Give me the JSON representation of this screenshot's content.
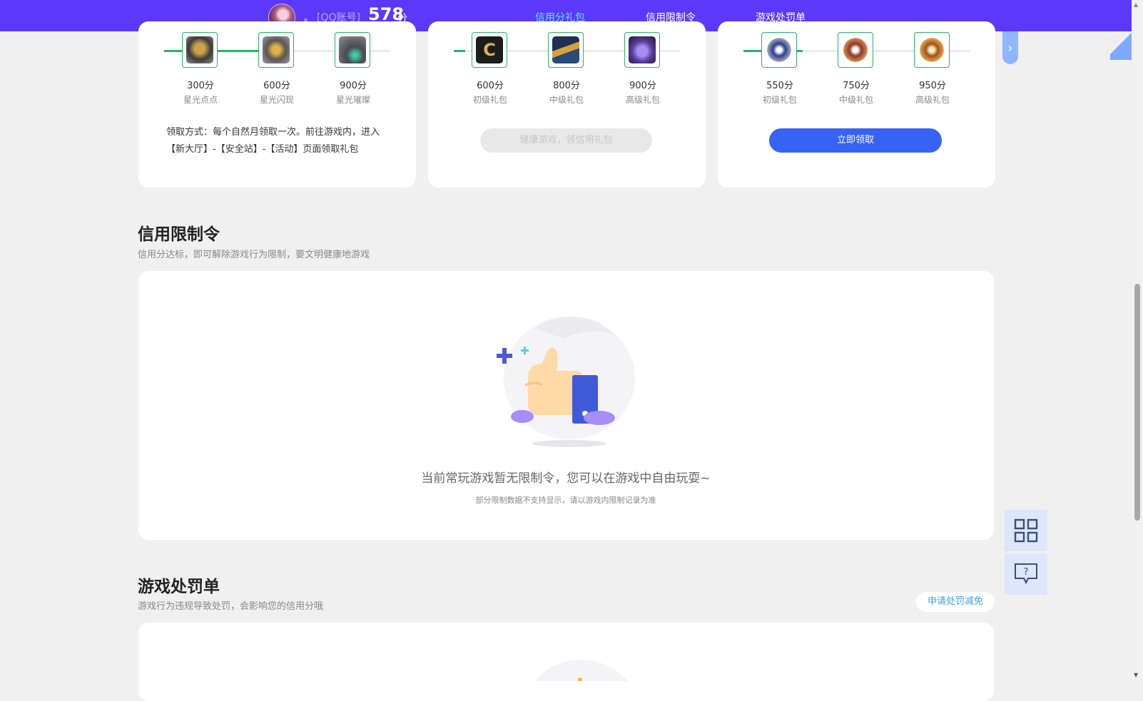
{
  "header": {
    "nickname": "。",
    "account_type": "[QQ账号]",
    "score": "578",
    "score_unit": "分",
    "tabs": [
      {
        "label": "信用分礼包",
        "active": true
      },
      {
        "label": "信用限制令",
        "active": false
      },
      {
        "label": "游戏处罚单",
        "active": false
      }
    ]
  },
  "gift_cards": [
    {
      "tiers": [
        {
          "points": "300分",
          "name": "星光点点",
          "icon": "gold-mech-icon"
        },
        {
          "points": "600分",
          "name": "星光闪现",
          "icon": "gold-armor-icon"
        },
        {
          "points": "900分",
          "name": "星光璀璨",
          "icon": "dark-mech-icon"
        }
      ],
      "progress_reached_tiers": 2,
      "description": "领取方式：每个自然月领取一次。前往游戏内，进入【新大厅】-【安全站】-【活动】页面领取礼包"
    },
    {
      "tiers": [
        {
          "points": "600分",
          "name": "初级礼包",
          "icon": "c-emblem-icon"
        },
        {
          "points": "800分",
          "name": "中级礼包",
          "icon": "rifle-xp-icon"
        },
        {
          "points": "900分",
          "name": "高级礼包",
          "icon": "treasure-chest-icon"
        }
      ],
      "progress_reached_tiers": 0,
      "button_label": "健康游戏，领信用礼包",
      "button_enabled": false
    },
    {
      "tiers": [
        {
          "points": "550分",
          "name": "初级礼包",
          "icon": "silver-rank-badge-icon"
        },
        {
          "points": "750分",
          "name": "中级礼包",
          "icon": "bronze-rank-badge-icon"
        },
        {
          "points": "950分",
          "name": "高级礼包",
          "icon": "gold-rank-badge-icon"
        }
      ],
      "progress_reached_tiers": 1,
      "button_label": "立即领取",
      "button_enabled": true
    }
  ],
  "restriction_section": {
    "title": "信用限制令",
    "subtitle": "信用分达标，即可解除游戏行为限制，要文明健康地游戏",
    "empty_main": "当前常玩游戏暂无限制令，您可以在游戏中自由玩耍~",
    "empty_sub": "部分限制数据不支持显示，请以游戏内限制记录为准"
  },
  "penalty_section": {
    "title": "游戏处罚单",
    "subtitle": "游戏行为违规导致处罚，会影响您的信用分哦",
    "apply_link": "申请处罚减免"
  },
  "floating_buttons": [
    "qr-code-icon",
    "help-chat-icon"
  ],
  "colors": {
    "topbar": "#5b39fa",
    "active_tab": "#5fe3ff",
    "progress_green": "#27b36b",
    "primary_button": "#3763f5",
    "link_blue": "#3aa2e8"
  }
}
